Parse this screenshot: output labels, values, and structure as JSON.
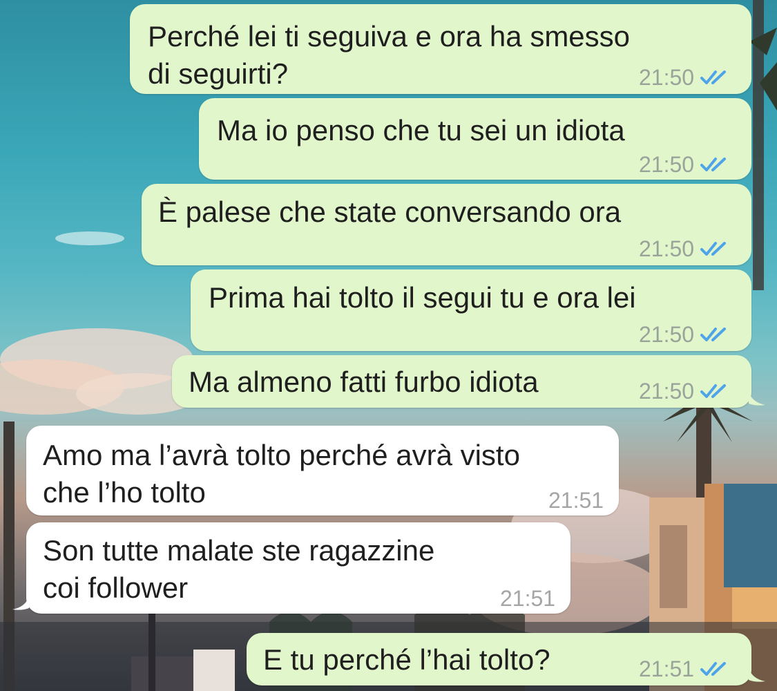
{
  "colors": {
    "outgoing_bubble": "#e1f7cb",
    "incoming_bubble": "#ffffff",
    "read_ticks": "#4fa3e8",
    "timestamp": "#9aa39a"
  },
  "messages": [
    {
      "direction": "outgoing",
      "text": "Perché lei ti seguiva e ora ha smesso\ndi seguirti?",
      "time": "21:50",
      "status_icon": "double-check-icon"
    },
    {
      "direction": "outgoing",
      "text": "Ma io penso che tu sei un idiota",
      "time": "21:50",
      "status_icon": "double-check-icon"
    },
    {
      "direction": "outgoing",
      "text": "È palese che state conversando ora",
      "time": "21:50",
      "status_icon": "double-check-icon"
    },
    {
      "direction": "outgoing",
      "text": "Prima hai tolto il segui tu e ora lei",
      "time": "21:50",
      "status_icon": "double-check-icon"
    },
    {
      "direction": "outgoing",
      "text": "Ma almeno fatti furbo idiota",
      "time": "21:50",
      "status_icon": "double-check-icon"
    },
    {
      "direction": "incoming",
      "text": "Amo ma l’avrà tolto perché avrà visto\nche l’ho tolto",
      "time": "21:51"
    },
    {
      "direction": "incoming",
      "text": "Son tutte malate ste ragazzine\ncoi follower",
      "time": "21:51"
    },
    {
      "direction": "outgoing",
      "text": "E tu perché l’hai tolto?",
      "time": "21:51",
      "status_icon": "double-check-icon"
    }
  ]
}
